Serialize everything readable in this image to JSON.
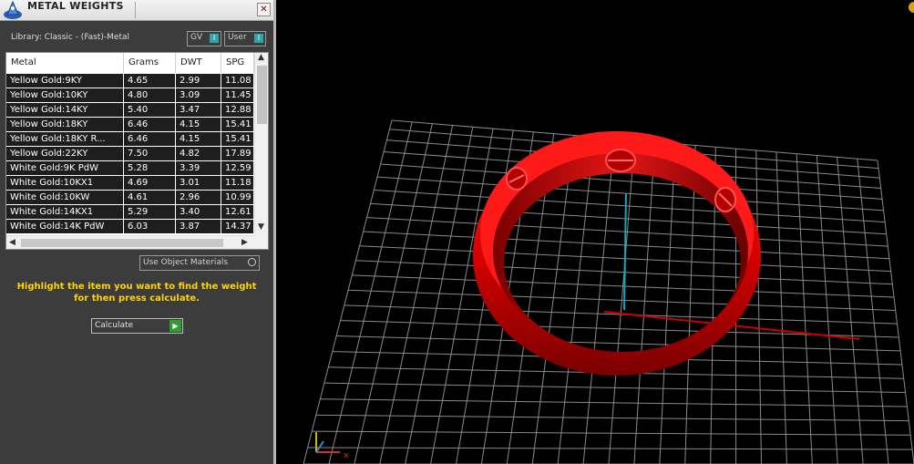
{
  "window": {
    "title": "METAL WEIGHTS",
    "close_label": "✕"
  },
  "library_label": "Library: Classic - (Fast)-Metal",
  "toggles": {
    "gv": {
      "label": "GV",
      "state": "I"
    },
    "user": {
      "label": "User",
      "state": "I"
    }
  },
  "table": {
    "headers": [
      "Metal",
      "Grams",
      "DWT",
      "SPG"
    ],
    "rows": [
      [
        "Yellow Gold:9KY",
        "4.65",
        "2.99",
        "11.08"
      ],
      [
        "Yellow Gold:10KY",
        "4.80",
        "3.09",
        "11.45"
      ],
      [
        "Yellow Gold:14KY",
        "5.40",
        "3.47",
        "12.88"
      ],
      [
        "Yellow Gold:18KY",
        "6.46",
        "4.15",
        "15.41"
      ],
      [
        "Yellow Gold:18KY R...",
        "6.46",
        "4.15",
        "15.41"
      ],
      [
        "Yellow Gold:22KY",
        "7.50",
        "4.82",
        "17.89"
      ],
      [
        "White Gold:9K PdW",
        "5.28",
        "3.39",
        "12.59"
      ],
      [
        "White Gold:10KX1",
        "4.69",
        "3.01",
        "11.18"
      ],
      [
        "White Gold:10KW",
        "4.61",
        "2.96",
        "10.99"
      ],
      [
        "White Gold:14KX1",
        "5.29",
        "3.40",
        "12.61"
      ],
      [
        "White Gold:14K PdW",
        "6.03",
        "3.87",
        "14.37"
      ]
    ]
  },
  "use_object_materials_label": "Use Object Materials",
  "hint_text": "Highlight the item you want to find the weight for then press calculate.",
  "calculate_label": "Calculate",
  "colors": {
    "panel_bg": "#3c3c3c",
    "hint": "#ffd400",
    "ring": "#e00000",
    "grid": "#8a8a8a",
    "axis_y": "#17a3b8",
    "axis_x": "#cc0000"
  },
  "icons": [
    "app-logo-icon",
    "close-icon",
    "scroll-up-icon",
    "scroll-down-icon",
    "scroll-left-icon",
    "scroll-right-icon",
    "play-icon",
    "axis-gizmo-icon"
  ]
}
